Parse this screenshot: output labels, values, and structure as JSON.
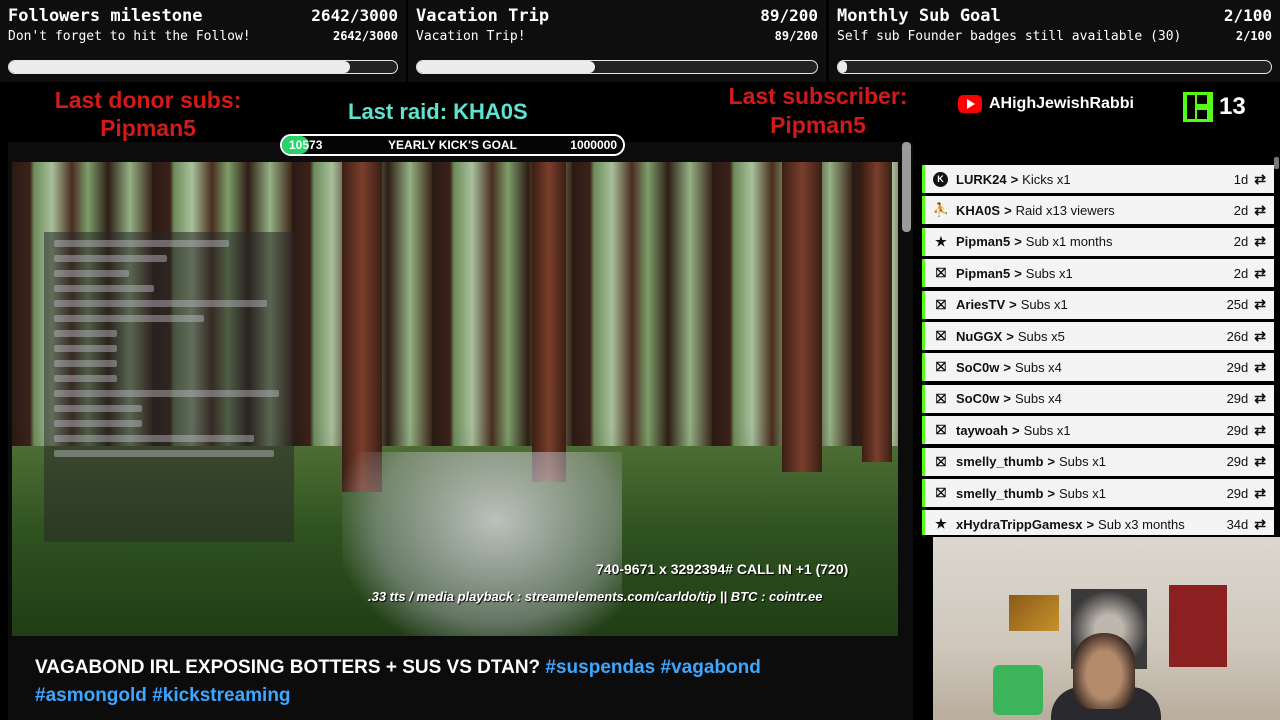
{
  "goals": [
    {
      "title": "Followers milestone",
      "subtitle": "Don't forget to hit the Follow!",
      "count": "2642/3000",
      "progress": 0.88
    },
    {
      "title": "Vacation Trip",
      "subtitle": "Vacation Trip!",
      "count": "89/200",
      "progress": 0.445
    },
    {
      "title": "Monthly Sub Goal",
      "subtitle": "Self sub Founder badges still available (30)",
      "count": "2/100",
      "progress": 0.02
    }
  ],
  "alerts": {
    "last_donor_label": "Last donor subs:",
    "last_donor_name": "Pipman5",
    "last_raid": "Last raid: KHA0S",
    "last_subscriber_label": "Last subscriber:",
    "last_subscriber_name": "Pipman5",
    "youtube_name": "AHighJewishRabbi",
    "kick_count": "13"
  },
  "yearly_goal": {
    "current": "10573",
    "title": "YEARLY KICK'S GOAL",
    "target": "1000000",
    "progress": 0.0106
  },
  "video": {
    "ticker1": "740-9671 x 3292394#   CALL IN +1 (720)",
    "ticker2": ".33 tts / media playback : streamelements.com/carldo/tip || BTC : cointr.ee"
  },
  "stream_title": {
    "text": "VAGABOND IRL EXPOSING BOTTERS + SUS VS DTAN? ",
    "tags": [
      "#suspendas",
      "#vagabond",
      "#asmongold",
      "#kickstreaming"
    ]
  },
  "events": [
    {
      "icon": "kick-icon",
      "user": "LURK24",
      "text": "Kicks x1",
      "time": "1d"
    },
    {
      "icon": "raid-icon",
      "user": "KHA0S",
      "text": "Raid x13 viewers",
      "time": "2d"
    },
    {
      "icon": "star-icon",
      "user": "Pipman5",
      "text": "Sub x1 months",
      "time": "2d"
    },
    {
      "icon": "gift-icon",
      "user": "Pipman5",
      "text": "Subs x1",
      "time": "2d"
    },
    {
      "icon": "gift-icon",
      "user": "AriesTV",
      "text": "Subs x1",
      "time": "25d"
    },
    {
      "icon": "gift-icon",
      "user": "NuGGX",
      "text": "Subs x5",
      "time": "26d"
    },
    {
      "icon": "gift-icon",
      "user": "SoC0w",
      "text": "Subs x4",
      "time": "29d"
    },
    {
      "icon": "gift-icon",
      "user": "SoC0w",
      "text": "Subs x4",
      "time": "29d"
    },
    {
      "icon": "gift-icon",
      "user": "taywoah",
      "text": "Subs x1",
      "time": "29d"
    },
    {
      "icon": "gift-icon",
      "user": "smelly_thumb",
      "text": "Subs x1",
      "time": "29d"
    },
    {
      "icon": "gift-icon",
      "user": "smelly_thumb",
      "text": "Subs x1",
      "time": "29d"
    },
    {
      "icon": "star-icon",
      "user": "xHydraTrippGamesx",
      "text": "Sub x3 months",
      "time": "34d"
    }
  ],
  "event_separator": ">",
  "event_replay_glyph": "⇄"
}
